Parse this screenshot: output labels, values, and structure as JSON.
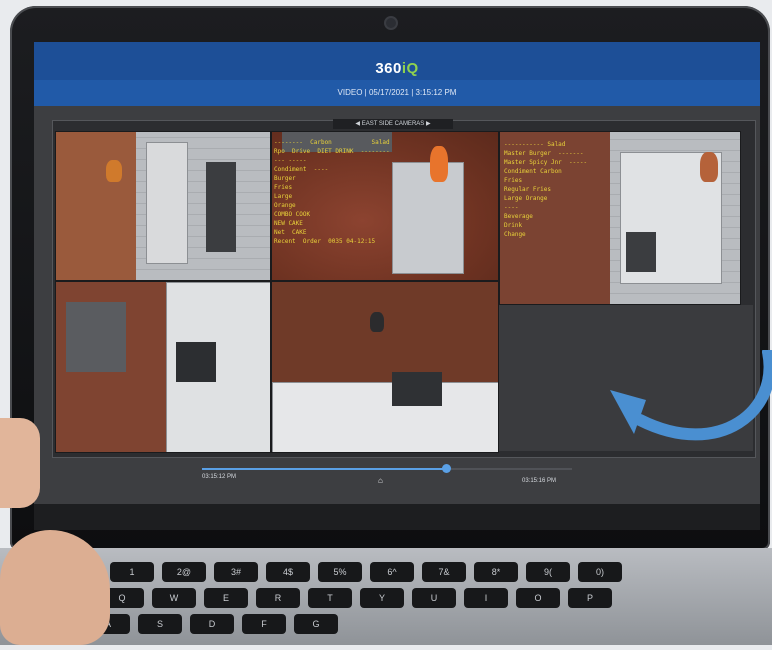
{
  "app": {
    "brand_main": "360",
    "brand_accent": "iQ",
    "subtitle": "VIDEO | 05/17/2021 | 3:15:12 PM",
    "grid_caption": "◀ EAST SIDE CAMERAS ▶"
  },
  "cameras": [
    {
      "id": "cam1",
      "overlay": ""
    },
    {
      "id": "cam2",
      "overlay": "--------  Carbon           Salad\nRpo  Drive  DIET DRINK  --------\n--- -----\nCondiment  ----\nBurger\nFries\nLarge\nOrange\nCOMBO COOK\nNEW CAKE\nNet  CAKE\nRecent  Order  0035 04-12:15"
    },
    {
      "id": "cam3",
      "overlay": "----------- Salad\nMaster Burger  -------\nMaster Spicy Jnr  -----\nCondiment Carbon\nFries\nRegular Fries\nLarge Orange\n----\nBeverage\nDrink\nChange"
    },
    {
      "id": "cam4",
      "overlay": ""
    },
    {
      "id": "cam5",
      "overlay": ""
    }
  ],
  "timeline": {
    "start_label": "03:15:12 PM",
    "end_label": "03:15:16 PM",
    "progress": 0.66
  },
  "keyboard": {
    "row1": [
      "1",
      "2@",
      "3#",
      "4$",
      "5%",
      "6^",
      "7&",
      "8*",
      "9(",
      "0)"
    ],
    "row2": [
      "Q",
      "W",
      "E",
      "R",
      "T",
      "Y",
      "U",
      "I",
      "O",
      "P"
    ],
    "row3": [
      "A",
      "S",
      "D",
      "F",
      "G"
    ]
  },
  "colors": {
    "header_blue": "#215aa8",
    "accent_green": "#8fd14f",
    "overlay_yellow": "#e8d23a",
    "arrow_blue": "#4a8fd1"
  }
}
